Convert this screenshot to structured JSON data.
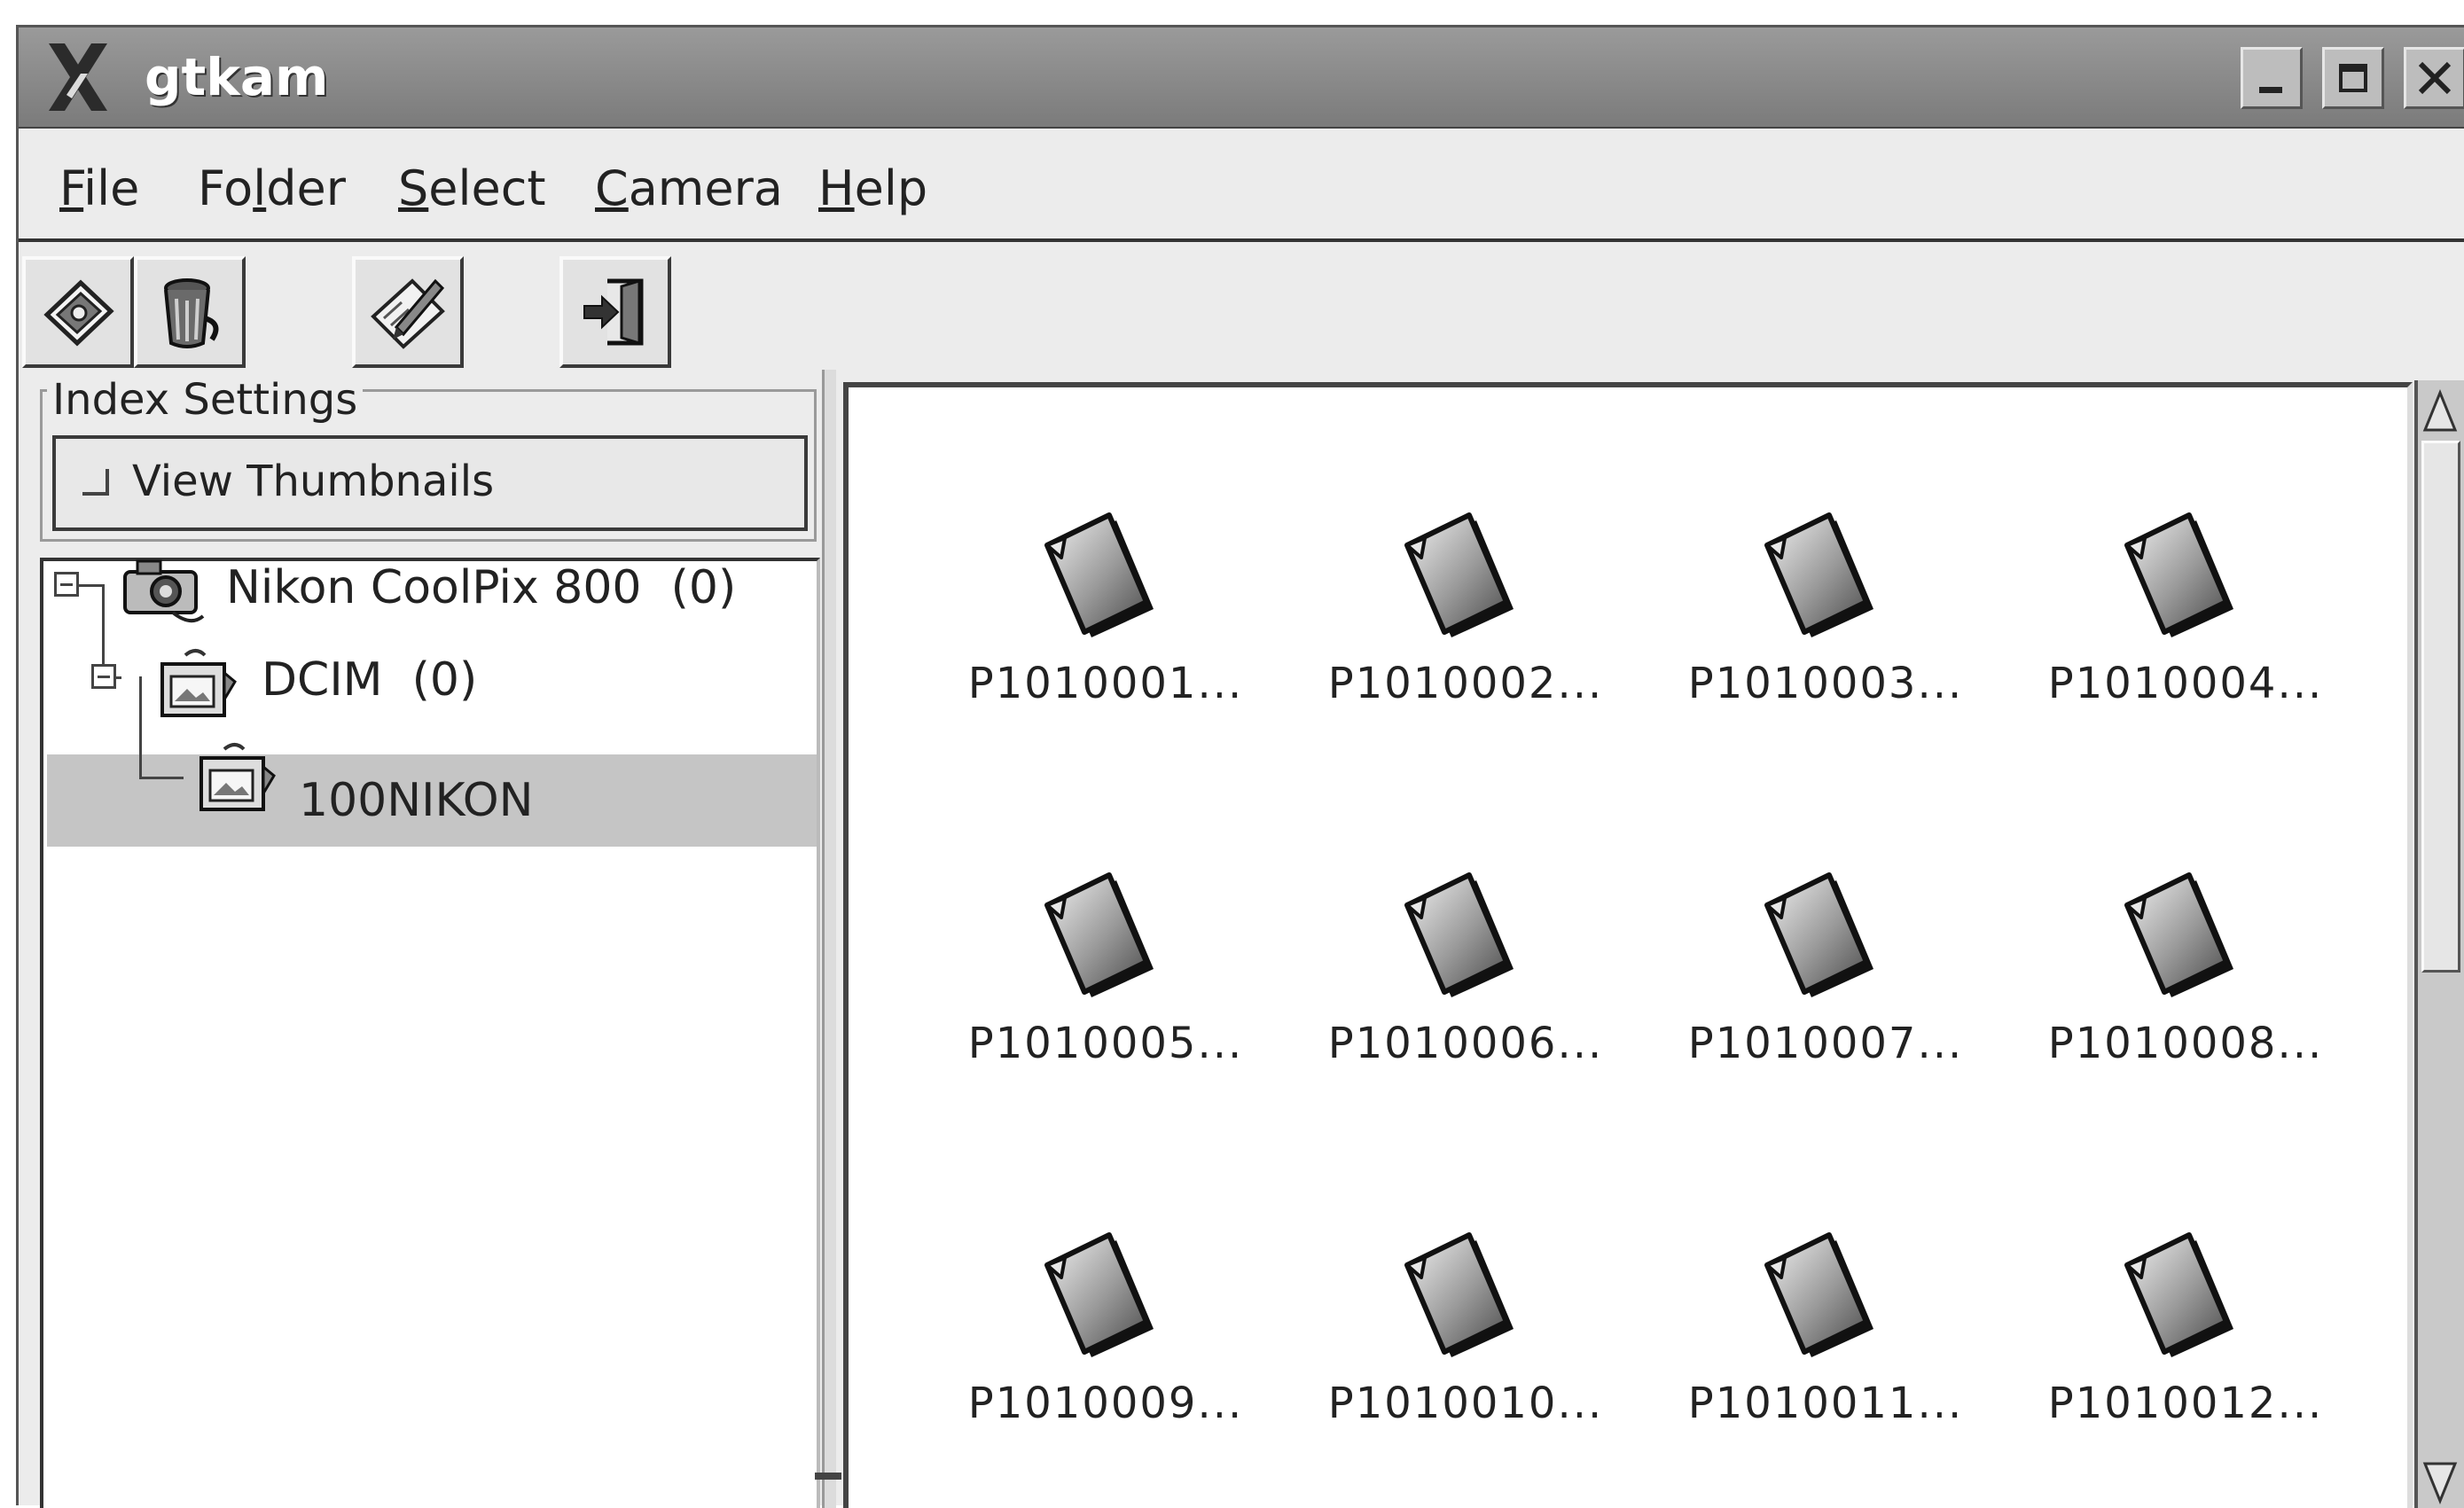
{
  "window": {
    "title": "gtkam"
  },
  "menubar": {
    "items": [
      {
        "label_ul": "F",
        "label_rest": "ile"
      },
      {
        "label_pre": "Fo",
        "label_ul": "l",
        "label_rest": "der"
      },
      {
        "label_ul": "S",
        "label_rest": "elect"
      },
      {
        "label_ul": "C",
        "label_rest": "amera"
      },
      {
        "label_ul": "H",
        "label_rest": "elp"
      }
    ]
  },
  "toolbar": {
    "icons": [
      "save-icon",
      "delete-icon",
      "preferences-icon",
      "exit-icon"
    ]
  },
  "index_settings": {
    "legend": "Index Settings",
    "view_thumbnails_label": "View Thumbnails",
    "view_thumbnails_checked": false
  },
  "tree": {
    "camera": {
      "name": "Nikon CoolPix 800",
      "count": "(0)"
    },
    "dcim": {
      "name": "DCIM",
      "count": "(0)"
    },
    "folder": {
      "name": "100NIKON",
      "selected": true
    }
  },
  "files": [
    {
      "name": "P1010001..."
    },
    {
      "name": "P1010002..."
    },
    {
      "name": "P1010003..."
    },
    {
      "name": "P1010004..."
    },
    {
      "name": "P1010005..."
    },
    {
      "name": "P1010006..."
    },
    {
      "name": "P1010007..."
    },
    {
      "name": "P1010008..."
    },
    {
      "name": "P1010009..."
    },
    {
      "name": "P1010010..."
    },
    {
      "name": "P1010011..."
    },
    {
      "name": "P1010012..."
    }
  ],
  "colors": {
    "titlebar": "#8a8a8a",
    "selection": "#c5c5c5",
    "window_bg": "#ececec"
  }
}
